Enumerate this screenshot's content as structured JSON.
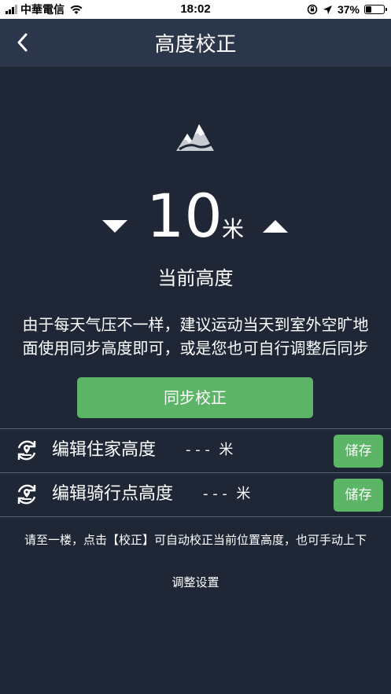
{
  "status_bar": {
    "carrier": "中華電信",
    "time": "18:02",
    "battery": "37%",
    "battery_level": 0.37
  },
  "nav": {
    "title": "高度校正",
    "back_icon": "chevron-left-icon"
  },
  "icon": "mountain-icon",
  "height": {
    "value": "10",
    "unit": "米",
    "label": "当前高度"
  },
  "tip": {
    "line1": "由于每天气压不一样，建议运动当天到室外空旷地",
    "line2": "面使用同步高度即可，或是您也可自行调整后同步"
  },
  "sync_button": "同步校正",
  "rows": [
    {
      "label": "编辑住家高度",
      "value": "- - -  米",
      "save": "储存",
      "icon": "sync-location-icon"
    },
    {
      "label": "编辑骑行点高度",
      "value": "- - -  米",
      "save": "储存",
      "icon": "sync-location-icon"
    }
  ],
  "footer": {
    "line1": "请至一楼，点击【校正】可自动校正当前位置高度，也可手动上下",
    "line2": "调整设置"
  },
  "colors": {
    "background": "#1f2736",
    "nav": "#2b364a",
    "accent": "#5cb466"
  }
}
